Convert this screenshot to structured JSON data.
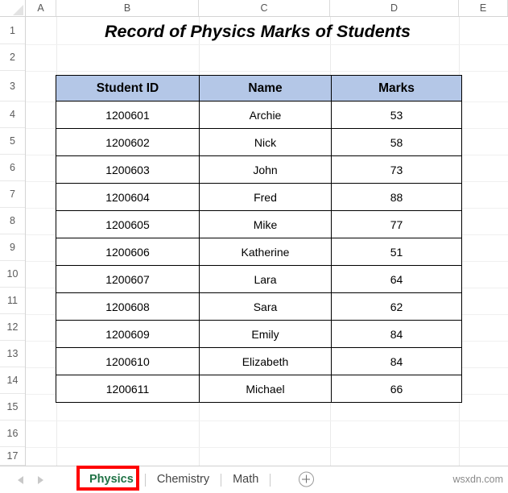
{
  "grid": {
    "columns": [
      "A",
      "B",
      "C",
      "D",
      "E"
    ],
    "rows": [
      "1",
      "2",
      "3",
      "4",
      "5",
      "6",
      "7",
      "8",
      "9",
      "10",
      "11",
      "12",
      "13",
      "14",
      "15",
      "16",
      "17"
    ]
  },
  "title": "Record of Physics Marks of Students",
  "table": {
    "headers": [
      "Student ID",
      "Name",
      "Marks"
    ],
    "header_fill": "#B4C7E7",
    "rows": [
      {
        "id": "1200601",
        "name": "Archie",
        "marks": "53"
      },
      {
        "id": "1200602",
        "name": "Nick",
        "marks": "58"
      },
      {
        "id": "1200603",
        "name": "John",
        "marks": "73"
      },
      {
        "id": "1200604",
        "name": "Fred",
        "marks": "88"
      },
      {
        "id": "1200605",
        "name": "Mike",
        "marks": "77"
      },
      {
        "id": "1200606",
        "name": "Katherine",
        "marks": "51"
      },
      {
        "id": "1200607",
        "name": "Lara",
        "marks": "64"
      },
      {
        "id": "1200608",
        "name": "Sara",
        "marks": "62"
      },
      {
        "id": "1200609",
        "name": "Emily",
        "marks": "84"
      },
      {
        "id": "1200610",
        "name": "Elizabeth",
        "marks": "84"
      },
      {
        "id": "1200611",
        "name": "Michael",
        "marks": "66"
      }
    ]
  },
  "tabbar": {
    "sheets": [
      {
        "label": "Physics",
        "active": true
      },
      {
        "label": "Chemistry",
        "active": false
      },
      {
        "label": "Math",
        "active": false
      }
    ],
    "prev_icon": "nav-left-arrow-icon",
    "next_icon": "nav-right-arrow-icon",
    "add_icon": "plus-circle-icon",
    "highlight_color": "#FF0000",
    "active_tab_color": "#217346"
  },
  "watermark": "wsxdn.com"
}
